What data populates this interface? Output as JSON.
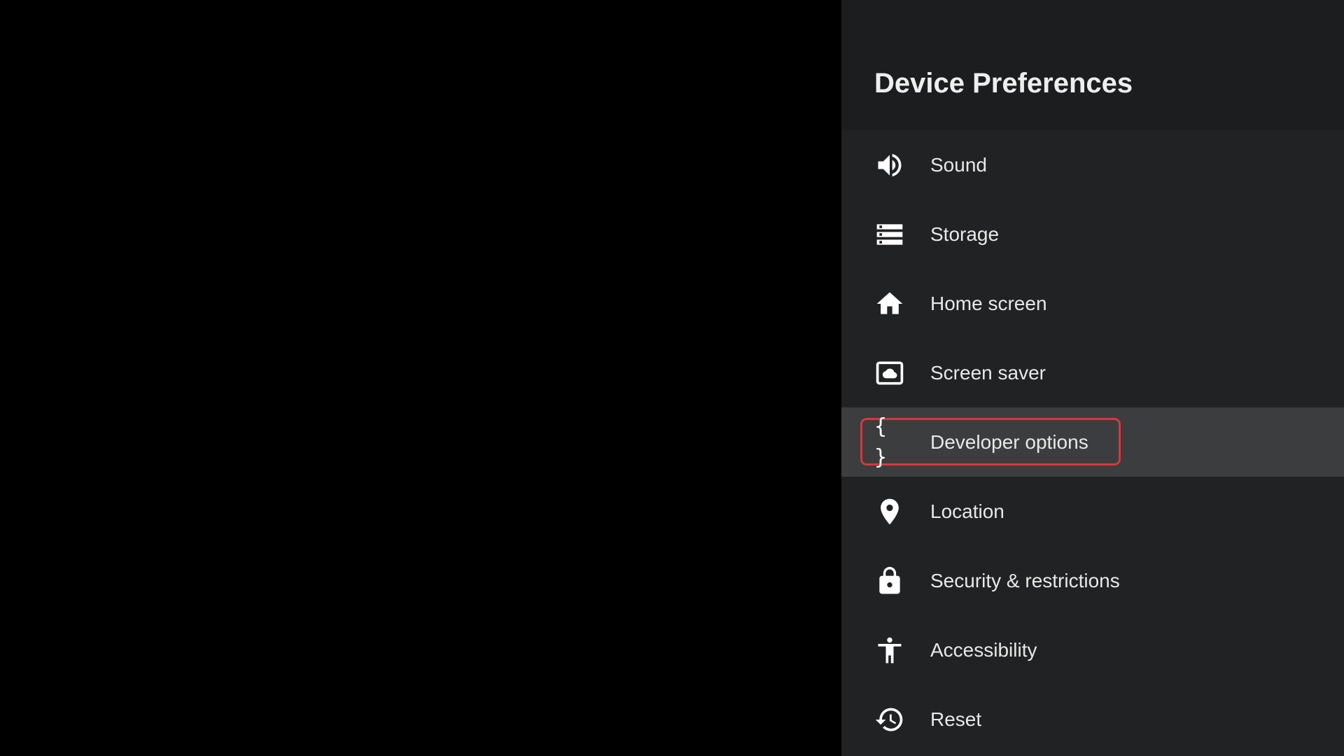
{
  "panel": {
    "title": "Device Preferences"
  },
  "menu": {
    "items": [
      {
        "label": "Sound",
        "icon": "speaker-icon"
      },
      {
        "label": "Storage",
        "icon": "storage-icon"
      },
      {
        "label": "Home screen",
        "icon": "home-icon"
      },
      {
        "label": "Screen saver",
        "icon": "screen-saver-icon"
      },
      {
        "label": "Developer options",
        "icon": "braces-icon",
        "focused": true,
        "glyph": "{ }"
      },
      {
        "label": "Location",
        "icon": "location-pin-icon"
      },
      {
        "label": "Security & restrictions",
        "icon": "lock-icon"
      },
      {
        "label": "Accessibility",
        "icon": "accessibility-icon"
      },
      {
        "label": "Reset",
        "icon": "history-icon"
      }
    ]
  },
  "colors": {
    "background": "#000000",
    "panel": "#212223",
    "header": "#1c1d1e",
    "focused_row": "#3c3d3e",
    "focus_ring": "#d9363e",
    "text": "#e8e8e8"
  }
}
